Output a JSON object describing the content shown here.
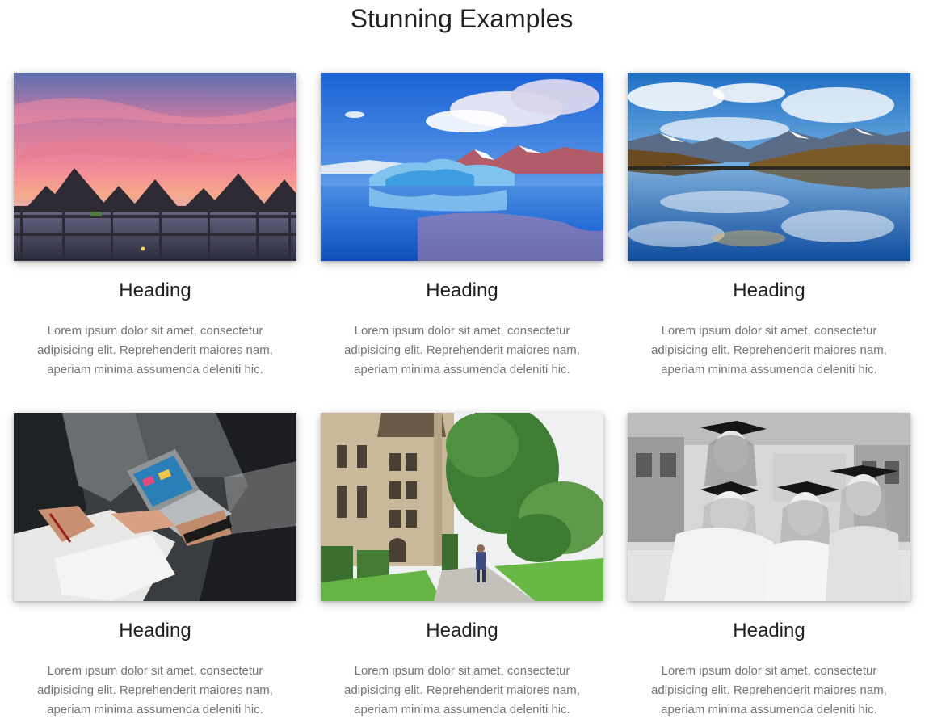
{
  "page": {
    "title": "Stunning Examples"
  },
  "cards": [
    {
      "heading": "Heading",
      "text": "Lorem ipsum dolor sit amet, consectetur adipisicing elit. Reprehenderit maiores nam, aperiam minima assumenda deleniti hic.",
      "image": "sunset-overwater-bungalows-photo"
    },
    {
      "heading": "Heading",
      "text": "Lorem ipsum dolor sit amet, consectetur adipisicing elit. Reprehenderit maiores nam, aperiam minima assumenda deleniti hic.",
      "image": "glacier-iceberg-lake-photo"
    },
    {
      "heading": "Heading",
      "text": "Lorem ipsum dolor sit amet, consectetur adipisicing elit. Reprehenderit maiores nam, aperiam minima assumenda deleniti hic.",
      "image": "mountain-lake-reflection-photo"
    },
    {
      "heading": "Heading",
      "text": "Lorem ipsum dolor sit amet, consectetur adipisicing elit. Reprehenderit maiores nam, aperiam minima assumenda deleniti hic.",
      "image": "team-meeting-laptop-photo"
    },
    {
      "heading": "Heading",
      "text": "Lorem ipsum dolor sit amet, consectetur adipisicing elit. Reprehenderit maiores nam, aperiam minima assumenda deleniti hic.",
      "image": "college-campus-walkway-photo"
    },
    {
      "heading": "Heading",
      "text": "Lorem ipsum dolor sit amet, consectetur adipisicing elit. Reprehenderit maiores nam, aperiam minima assumenda deleniti hic.",
      "image": "graduates-caps-bw-photo"
    }
  ]
}
